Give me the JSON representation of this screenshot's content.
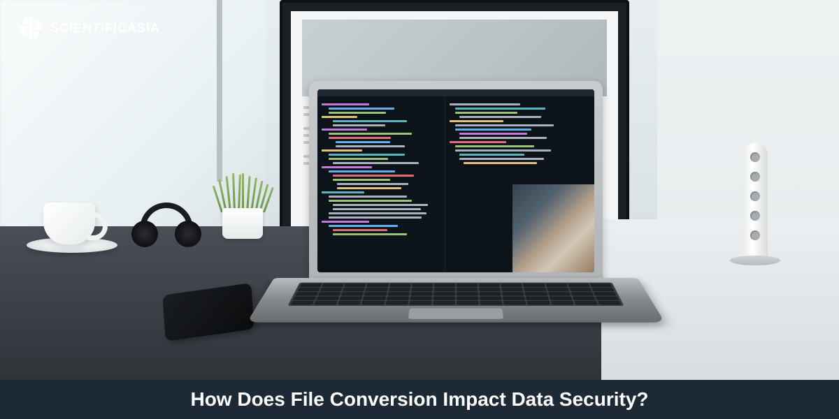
{
  "brand": {
    "name": "SCIENTIFICASIA",
    "icon": "scientificasia-logo-icon"
  },
  "caption": {
    "text": "How Does File Conversion Impact Data Security?"
  },
  "colors": {
    "caption_bg": "#1e2936",
    "caption_fg": "#ffffff",
    "brand_fg": "#ffffff"
  },
  "scene": {
    "objects": [
      "laptop",
      "external-monitor",
      "coffee-mug",
      "headphones",
      "plant",
      "smartphone",
      "wifi-router",
      "desk"
    ],
    "laptop_screen": "code-editor-dark-theme",
    "monitor_screen": "document-page-light"
  }
}
